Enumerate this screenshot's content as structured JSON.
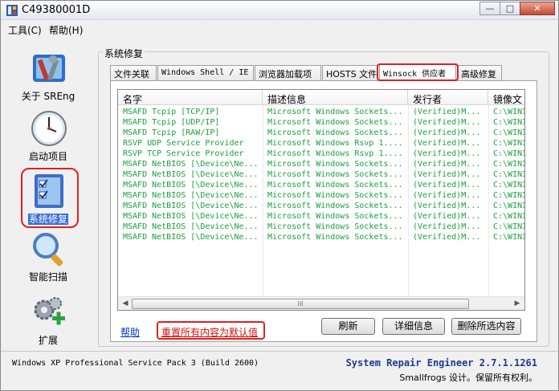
{
  "window": {
    "title": "C49380001D",
    "buttons": {
      "minimize": "—",
      "maximize": "□",
      "close": "✕"
    }
  },
  "menu": [
    {
      "label": "工具(C)"
    },
    {
      "label": "帮助(H)"
    }
  ],
  "sidebar": {
    "items": [
      {
        "label": "关于 SREng",
        "icon": "tools-icon"
      },
      {
        "label": "启动项目",
        "icon": "clock-icon"
      },
      {
        "label": "系统修复",
        "icon": "clipboard-check-icon",
        "selected": true
      },
      {
        "label": "智能扫描",
        "icon": "magnifier-icon"
      },
      {
        "label": "扩展",
        "icon": "gears-plus-icon"
      }
    ]
  },
  "main": {
    "group_label": "系统修复",
    "tabs": [
      {
        "label": "文件关联"
      },
      {
        "label": "Windows Shell / IE"
      },
      {
        "label": "浏览器加载项"
      },
      {
        "label": "HOSTS 文件"
      },
      {
        "label": "Winsock 供应者",
        "active": true
      },
      {
        "label": "高级修复"
      }
    ],
    "columns": [
      "名字",
      "描述信息",
      "发行者",
      "镜像文"
    ],
    "rows": [
      [
        "MSAFD Tcpip [TCP/IP]",
        "Microsoft Windows Sockets...",
        "(Verified)M...",
        "C:\\WINI"
      ],
      [
        "MSAFD Tcpip [UDP/IP]",
        "Microsoft Windows Sockets...",
        "(Verified)M...",
        "C:\\WINI"
      ],
      [
        "MSAFD Tcpip [RAW/IP]",
        "Microsoft Windows Sockets...",
        "(Verified)M...",
        "C:\\WINI"
      ],
      [
        "RSVP UDP Service Provider",
        "Microsoft Windows Rsvp 1....",
        "(Verified)M...",
        "C:\\WINI"
      ],
      [
        "RSVP TCP Service Provider",
        "Microsoft Windows Rsvp 1....",
        "(Verified)M...",
        "C:\\WINI"
      ],
      [
        "MSAFD NetBIOS [\\Device\\Ne...",
        "Microsoft Windows Sockets...",
        "(Verified)M...",
        "C:\\WINI"
      ],
      [
        "MSAFD NetBIOS [\\Device\\Ne...",
        "Microsoft Windows Sockets...",
        "(Verified)M...",
        "C:\\WINI"
      ],
      [
        "MSAFD NetBIOS [\\Device\\Ne...",
        "Microsoft Windows Sockets...",
        "(Verified)M...",
        "C:\\WINI"
      ],
      [
        "MSAFD NetBIOS [\\Device\\Ne...",
        "Microsoft Windows Sockets...",
        "(Verified)M...",
        "C:\\WINI"
      ],
      [
        "MSAFD NetBIOS [\\Device\\Ne...",
        "Microsoft Windows Sockets...",
        "(Verified)M...",
        "C:\\WINI"
      ],
      [
        "MSAFD NetBIOS [\\Device\\Ne...",
        "Microsoft Windows Sockets...",
        "(Verified)M...",
        "C:\\WINI"
      ],
      [
        "MSAFD NetBIOS [\\Device\\Ne...",
        "Microsoft Windows Sockets...",
        "(Verified)M...",
        "C:\\WINI"
      ],
      [
        "MSAFD NetBIOS [\\Device\\Ne...",
        "Microsoft Windows Sockets...",
        "(Verified)M...",
        "C:\\WINI"
      ]
    ],
    "scroll_thumb_grip": "III",
    "help_link": "帮助",
    "reset_link": "重置所有内容为默认值",
    "buttons": {
      "refresh": "刷新",
      "details": "详细信息",
      "delete": "删除所选内容"
    }
  },
  "status": {
    "os": "Windows XP Professional Service Pack 3 (Build 2600)",
    "product": "System Repair Engineer 2.7.1.1261",
    "copyright": "Smallfrogs 设计。保留所有权利。"
  },
  "colors": {
    "row_text": "#1aa03c",
    "highlight_ring": "#e02020",
    "product_text": "#1c3c8c",
    "selection": "#3a6fd8"
  }
}
